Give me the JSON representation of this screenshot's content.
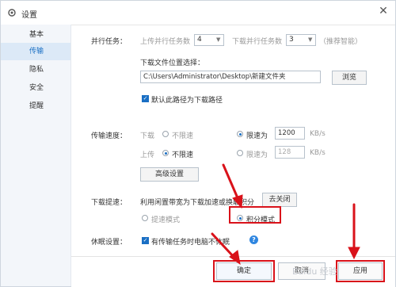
{
  "window": {
    "title": "设置",
    "close_glyph": "✕"
  },
  "sidebar": {
    "items": [
      {
        "label": "基本",
        "active": false
      },
      {
        "label": "传输",
        "active": true
      },
      {
        "label": "隐私",
        "active": false
      },
      {
        "label": "安全",
        "active": false
      },
      {
        "label": "提醒",
        "active": false
      }
    ]
  },
  "parallel": {
    "label": "并行任务：",
    "upload_label": "上传并行任务数",
    "upload_value": "4",
    "download_label": "下载并行任务数",
    "download_value": "3",
    "hint": "（推荐智能）"
  },
  "download_location": {
    "label": "下载文件位置选择：",
    "path": "C:\\Users\\Administrator\\Desktop\\新建文件夹",
    "browse_button": "浏览",
    "default_checkbox_label": "默认此路径为下载路径",
    "default_checked": true
  },
  "speed": {
    "label": "传输速度：",
    "download": {
      "label": "下载",
      "unlimited": "不限速",
      "limit": "限速为",
      "value": "1200",
      "unit": "KB/s",
      "selected": "limit"
    },
    "upload": {
      "label": "上传",
      "unlimited": "不限速",
      "limit": "限速为",
      "value": "128",
      "unit": "KB/s",
      "selected": "unlimited"
    },
    "advanced_button": "高级设置"
  },
  "boost": {
    "label": "下载提速：",
    "description": "利用闲置带宽为下载加速或换取积分",
    "close_button": "去关闭",
    "mode_speed": "提速模式",
    "mode_points": "积分模式",
    "selected": "points"
  },
  "sleep": {
    "label": "休眠设置：",
    "checkbox_label": "有传输任务时电脑不休眠",
    "checked": true
  },
  "footer": {
    "ok": "确定",
    "cancel": "取消",
    "apply": "应用"
  },
  "watermark": "Baidu 经验",
  "colors": {
    "accent": "#1a6fc4",
    "annotation": "#d9121a"
  }
}
